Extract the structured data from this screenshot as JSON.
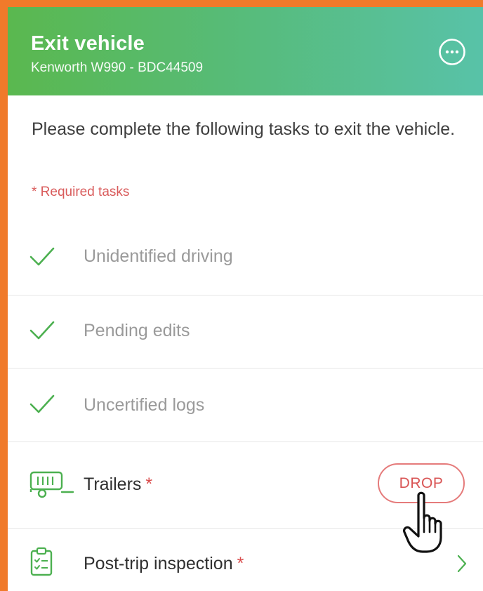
{
  "header": {
    "title": "Exit vehicle",
    "subtitle": "Kenworth W990 - BDC44509",
    "more_icon": "ellipsis-circle-icon"
  },
  "intro_text": "Please complete the following tasks to exit the vehicle.",
  "required_note": "* Required tasks",
  "tasks": [
    {
      "label": "Unidentified driving",
      "status": "done",
      "icon": "check-icon"
    },
    {
      "label": "Pending edits",
      "status": "done",
      "icon": "check-icon"
    },
    {
      "label": "Uncertified logs",
      "status": "done",
      "icon": "check-icon"
    },
    {
      "label": "Trailers",
      "required_mark": "*",
      "status": "required",
      "icon": "trailer-icon",
      "action_label": "DROP"
    },
    {
      "label": "Post-trip inspection",
      "required_mark": "*",
      "status": "required",
      "icon": "clipboard-checklist-icon",
      "trailing_icon": "chevron-right-icon"
    }
  ],
  "colors": {
    "frame_orange": "#f07a2a",
    "header_green_start": "#5ab84f",
    "header_teal_end": "#58c2a8",
    "check_green": "#4cb050",
    "required_red": "#d95b5b"
  }
}
